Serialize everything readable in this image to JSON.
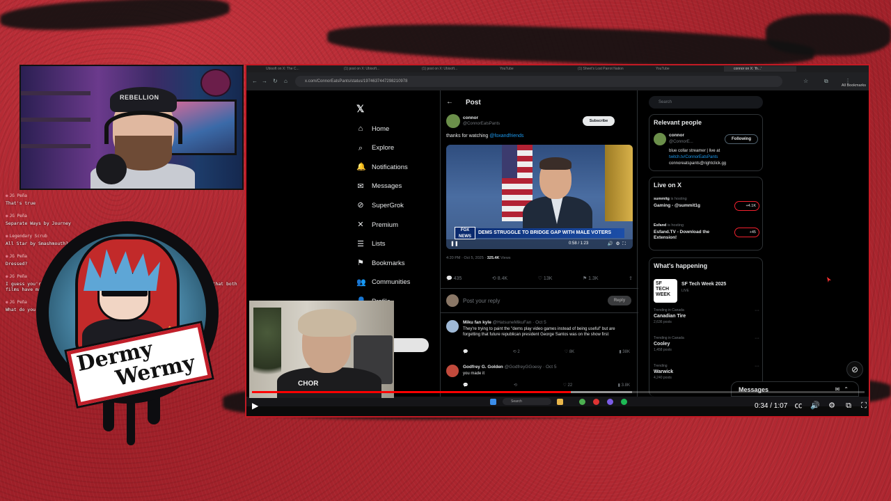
{
  "chat": {
    "messages": [
      {
        "user": "JG Peña",
        "text": "That's true"
      },
      {
        "user": "JG Peña",
        "text": "Separate Ways by Journey"
      },
      {
        "user": "Legendary Scrub",
        "text": "All Star by Smashmouth?"
      },
      {
        "user": "JG Peña",
        "text": "Dressed?"
      },
      {
        "user": "JG Peña",
        "text": "I guess you're right most of the people I've seen make videos about it. Say that both films have made a cult following"
      },
      {
        "user": "JG Peña",
        "text": "What do you mean? It came out"
      }
    ]
  },
  "webcam": {
    "cap_text": "REBELLION"
  },
  "logo": {
    "line1": "Dermy",
    "line2": "Wermy"
  },
  "browser": {
    "tabs": [
      "Ubisoft on X: The C...",
      "(1) post on X: Ubisoft...",
      "(1) post on X: Ubisoft...",
      "YouTube",
      "(1) Sheet's Lost Parrot Nation",
      "YouTube",
      "connor on X: 'th...'"
    ],
    "url": "x.com/ConnorEatsPants/status/1974637447298210978",
    "bookmarks": "All Bookmarks"
  },
  "x": {
    "nav": [
      {
        "label": "Home",
        "icon": "home-icon",
        "glyph": "⌂"
      },
      {
        "label": "Explore",
        "icon": "search-icon",
        "glyph": "⌕"
      },
      {
        "label": "Notifications",
        "icon": "bell-icon",
        "glyph": "🔔"
      },
      {
        "label": "Messages",
        "icon": "mail-icon",
        "glyph": "✉"
      },
      {
        "label": "SuperGrok",
        "icon": "grok-icon",
        "glyph": "⊘"
      },
      {
        "label": "Premium",
        "icon": "x-icon",
        "glyph": "✕"
      },
      {
        "label": "Lists",
        "icon": "list-icon",
        "glyph": "☰"
      },
      {
        "label": "Bookmarks",
        "icon": "bookmark-icon",
        "glyph": "⚑"
      },
      {
        "label": "Communities",
        "icon": "communities-icon",
        "glyph": "👥"
      },
      {
        "label": "Profile",
        "icon": "profile-icon",
        "glyph": "👤"
      }
    ],
    "post": {
      "header": "Post",
      "author": "connor",
      "handle": "@ConnorEatsPants",
      "subscribe": "Subscribe",
      "text_pre": "thanks for watching ",
      "mention": "@foxandfriends",
      "chyron": "DEMS STRUGGLE TO BRIDGE GAP WITH MALE VOTERS",
      "network": "FOX NEWS",
      "video_time": "0:58 / 1:23",
      "timestamp": "4:20 PM · Oct 5, 2025 · ",
      "views": "325.4K",
      "views_label": "Views",
      "stats": {
        "replies": "435",
        "reposts": "8.4K",
        "likes": "13K",
        "bookmarks": "1.3K"
      },
      "reply_placeholder": "Post your reply",
      "reply_button": "Reply"
    },
    "replies": [
      {
        "name": "Miku fan kyle",
        "handle": "@HatsuneMikuFan · Oct 5",
        "text": "They're trying to paint the \"dems play video games instead of being useful\" but are forgetting that future republican president George Santos was on the show first",
        "stats": [
          "",
          "2",
          "8K",
          "38K"
        ]
      },
      {
        "name": "Godfrey G. Golden",
        "handle": "@GodfreyGGoesy · Oct 5",
        "text": "you made it",
        "stats": [
          "",
          "",
          "22",
          "3.8K"
        ]
      }
    ],
    "search_placeholder": "Search",
    "relevant": {
      "title": "Relevant people",
      "name": "connor",
      "handle": "@ConnorE...",
      "follow": "Following",
      "bio1": "blue collar streamer | live at",
      "bio_link": "twitch.tv/ConnorEatsPants",
      "bio2": "connoreatspants@rightclick.gg"
    },
    "live": {
      "title": "Live on X",
      "items": [
        {
          "host": "summitg",
          "status": "is hosting",
          "title": "Gaming - @summit1g",
          "count": "+4.1K"
        },
        {
          "host": "Esfand",
          "status": "is hosting",
          "title": "Esfand.TV - Download the Extension!",
          "count": "+45"
        }
      ]
    },
    "happening": {
      "title": "What's happening",
      "event_thumb": "SF TECH WEEK",
      "event_name": "SF Tech Week 2025",
      "event_sub": "LIVE",
      "trends": [
        {
          "cat": "Trending in Canada",
          "name": "Canadian Tire",
          "posts": "2,636 posts"
        },
        {
          "cat": "Trending in Canada",
          "name": "Cooley",
          "posts": "1,458 posts"
        },
        {
          "cat": "Trending",
          "name": "Warwick",
          "posts": "4,240 posts"
        }
      ]
    },
    "messages_drawer": "Messages"
  },
  "overlay_cam": {
    "shirt_text": "CHOR"
  },
  "taskbar": {
    "search": "Search"
  },
  "player": {
    "time": "0:34 / 1:07",
    "progress": 0.52,
    "buffered": 0.62
  }
}
